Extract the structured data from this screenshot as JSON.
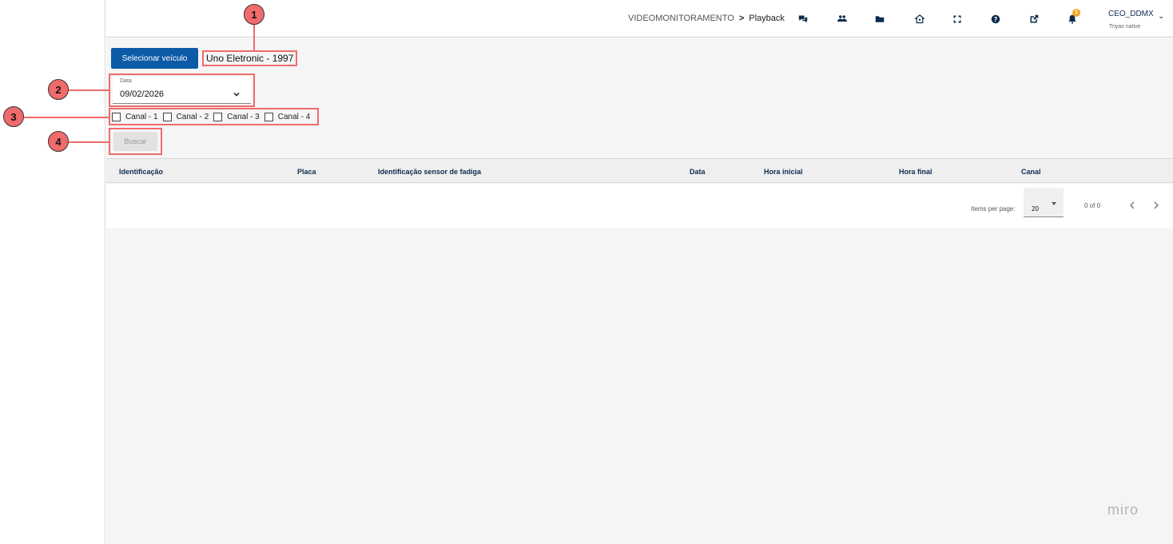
{
  "header": {
    "breadcrumb": {
      "parent": "VIDEOMONITORAMENTO",
      "separator": ">",
      "current": "Playback"
    },
    "icons": [
      {
        "name": "chat-icon"
      },
      {
        "name": "users-icon"
      },
      {
        "name": "folder-icon"
      },
      {
        "name": "home-icon"
      },
      {
        "name": "fullscreen-icon"
      },
      {
        "name": "help-icon"
      },
      {
        "name": "external-link-icon"
      },
      {
        "name": "notification-bell-icon",
        "badge": "1"
      }
    ],
    "user": {
      "name": "CEO_DDMX",
      "subtitle": "Triyax native",
      "chevron": "⌄"
    }
  },
  "filters": {
    "select_vehicle_label": "Selecionar veículo",
    "vehicle_name": "Uno Eletronic - 1997",
    "date_label": "Data",
    "date_value": "09/02/2026",
    "channels": [
      "Canal - 1",
      "Canal - 2",
      "Canal - 3",
      "Canal - 4"
    ],
    "search_label": "Buscar"
  },
  "table": {
    "columns": [
      "Identificação",
      "Placa",
      "Identificação sensor de fadiga",
      "Data",
      "Hora inicial",
      "Hora final",
      "Canal"
    ]
  },
  "pagination": {
    "items_per_page_label": "Items per page:",
    "items_per_page_value": "20",
    "range": "0 of 0"
  },
  "watermark": "miro",
  "callouts": [
    "1",
    "2",
    "3",
    "4"
  ],
  "colors": {
    "primary": "#0d5aa7",
    "highlight": "#f06b6b",
    "badge": "#f5a623",
    "header_text": "#0d2b4e"
  }
}
